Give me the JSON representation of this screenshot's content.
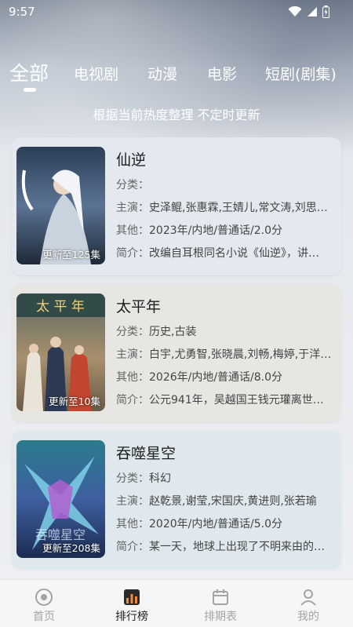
{
  "status_bar": {
    "time": "9:57"
  },
  "tabs": [
    {
      "label": "全部",
      "active": true
    },
    {
      "label": "电视剧",
      "active": false
    },
    {
      "label": "动漫",
      "active": false
    },
    {
      "label": "电影",
      "active": false
    },
    {
      "label": "短剧(剧集)",
      "active": false
    }
  ],
  "subtitle": "根据当前热度整理 不定时更新",
  "items": [
    {
      "title": "仙逆",
      "badge": "更新至125集",
      "genre_label": "分类：",
      "genre": "",
      "cast_label": "主演：",
      "cast": "史泽鲲,张惠霖,王婧儿,常文涛,刘思…",
      "other_label": "其他：",
      "other": "2023年/内地/普通话/2.0分",
      "intro_label": "简介：",
      "intro": "改编自耳根同名小说《仙逆》，讲…"
    },
    {
      "title": "太平年",
      "badge": "更新至10集",
      "genre_label": "分类：",
      "genre": "历史,古装",
      "cast_label": "主演：",
      "cast": "白宇,尤勇智,张晓晨,刘畅,梅婷,于洋…",
      "other_label": "其他：",
      "other": "2026年/内地/普通话/8.0分",
      "intro_label": "简介：",
      "intro": "公元941年，吴越国王钱元瓘离世…"
    },
    {
      "title": "吞噬星空",
      "badge": "更新至208集",
      "genre_label": "分类：",
      "genre": "科幻",
      "cast_label": "主演：",
      "cast": "赵乾景,谢莹,宋国庆,黄进则,张若瑜",
      "other_label": "其他：",
      "other": "2020年/内地/普通话/5.0分",
      "intro_label": "简介：",
      "intro": "某一天，地球上出现了不明来由的…"
    }
  ],
  "bottom_nav": [
    {
      "label": "首页",
      "icon": "home-icon",
      "active": false
    },
    {
      "label": "排行榜",
      "icon": "ranking-icon",
      "active": true
    },
    {
      "label": "排期表",
      "icon": "calendar-icon",
      "active": false
    },
    {
      "label": "我的",
      "icon": "profile-icon",
      "active": false
    }
  ],
  "colors": {
    "active_nav": "#222222",
    "inactive_nav": "#a4a4a8",
    "ranking_accent": "#f08a3e"
  }
}
